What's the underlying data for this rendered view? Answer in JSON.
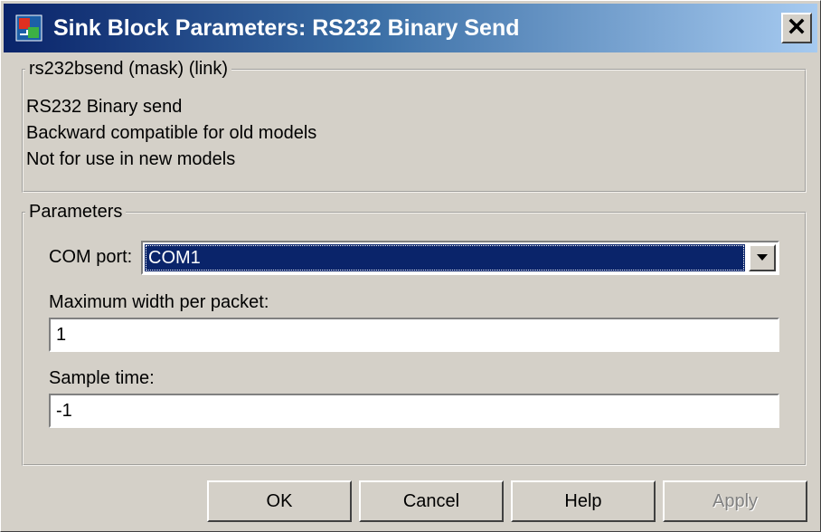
{
  "window": {
    "title": "Sink Block Parameters: RS232 Binary Send"
  },
  "mask_group": {
    "legend": "rs232bsend (mask) (link)",
    "description": [
      "RS232 Binary send",
      "Backward compatible for old models",
      "Not for use in new models"
    ]
  },
  "parameters": {
    "legend": "Parameters",
    "com_port_label": "COM port:",
    "com_port_value": "COM1",
    "max_width_label": "Maximum width per packet:",
    "max_width_value": "1",
    "sample_time_label": "Sample time:",
    "sample_time_value": "-1"
  },
  "buttons": {
    "ok": "OK",
    "cancel": "Cancel",
    "help": "Help",
    "apply": "Apply"
  },
  "icons": {
    "app": "simulink-block-icon",
    "close": "close-icon",
    "dropdown": "chevron-down-icon"
  },
  "colors": {
    "title_gradient_start": "#0a246a",
    "title_gradient_end": "#a6caf0",
    "dialog_face": "#d4d0c8",
    "selection": "#0a246a"
  }
}
